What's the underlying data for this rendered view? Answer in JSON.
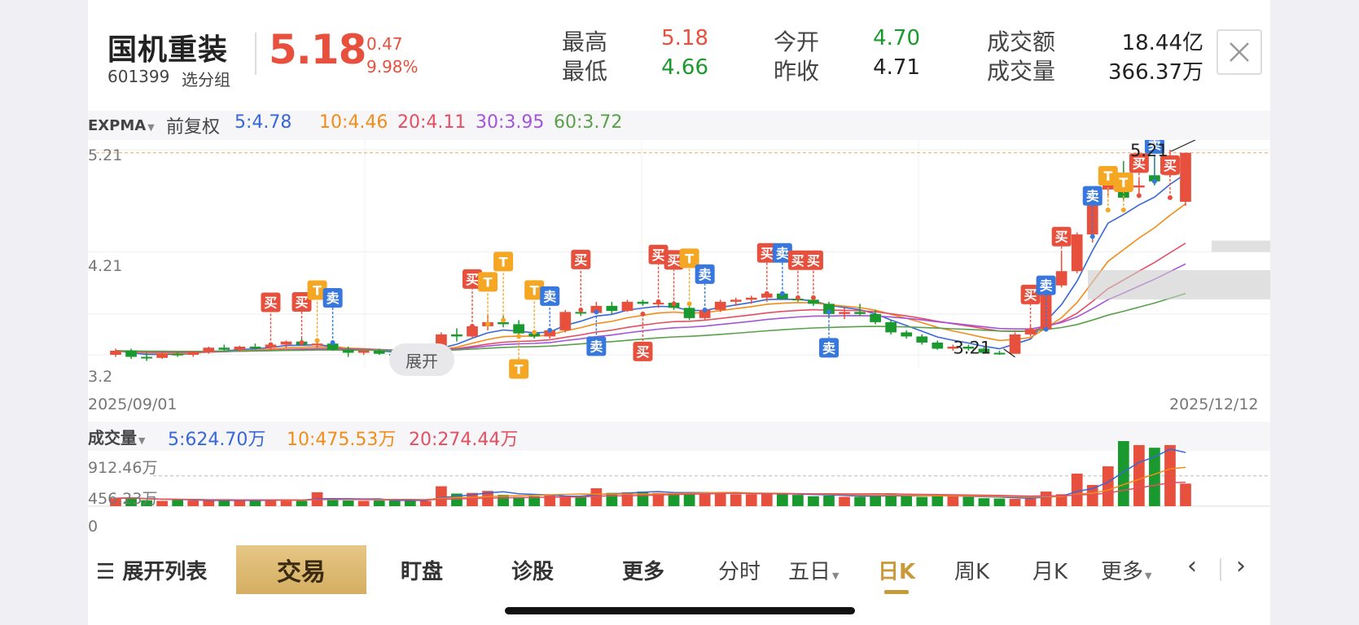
{
  "stock": {
    "name": "国机重装",
    "code": "601399",
    "group_label": "选分组",
    "price": "5.18",
    "change": "0.47",
    "change_pct": "9.98%"
  },
  "quotes": {
    "high_label": "最高",
    "high": "5.18",
    "low_label": "最低",
    "low": "4.66",
    "open_label": "今开",
    "open": "4.70",
    "prev_close_label": "昨收",
    "prev_close": "4.71",
    "amount_label": "成交额",
    "amount": "18.44亿",
    "volume_label": "成交量",
    "volume": "366.37万"
  },
  "close_icon": "close-icon",
  "indicator": {
    "selector": "EXPMA",
    "adjust": "前复权",
    "lines": [
      {
        "label": "5:4.78",
        "color": "#3866d8"
      },
      {
        "label": "10:4.46",
        "color": "#f28c18"
      },
      {
        "label": "20:4.11",
        "color": "#e34f62"
      },
      {
        "label": "30:3.95",
        "color": "#a454d8"
      },
      {
        "label": "60:3.72",
        "color": "#5aa04a"
      }
    ]
  },
  "price_axis": {
    "top": "5.21",
    "mid": "4.21",
    "low": "3.2"
  },
  "dates": {
    "start": "2025/09/01",
    "end": "2025/12/12"
  },
  "annotations": {
    "high_price": "5.21",
    "low_price": "3.21",
    "expand": "展开"
  },
  "volume": {
    "selector": "成交量",
    "lines": [
      {
        "label": "5:624.70万",
        "color": "#3866d8"
      },
      {
        "label": "10:475.53万",
        "color": "#f28c18"
      },
      {
        "label": "20:274.44万",
        "color": "#e34f62"
      }
    ],
    "axis_top": "912.46万",
    "axis_mid": "456.23万",
    "axis_zero": "0"
  },
  "signals": {
    "buy": "买",
    "sell": "卖",
    "t": "T"
  },
  "nav": {
    "expand_list": "展开列表",
    "trade": "交易",
    "watch": "盯盘",
    "diagnose": "诊股",
    "more": "更多",
    "tabs": [
      "分时",
      "五日",
      "日K",
      "周K",
      "月K",
      "更多"
    ],
    "active_tab": "日K"
  },
  "chart_data": {
    "type": "candlestick",
    "title": "",
    "x_range": [
      "2025/09/01",
      "2025/12/12"
    ],
    "ylim": [
      3.2,
      5.21
    ],
    "candles_ohlc": [
      [
        3.2,
        3.26,
        3.18,
        3.24
      ],
      [
        3.24,
        3.26,
        3.16,
        3.18
      ],
      [
        3.18,
        3.22,
        3.14,
        3.17
      ],
      [
        3.17,
        3.22,
        3.16,
        3.21
      ],
      [
        3.21,
        3.23,
        3.18,
        3.2
      ],
      [
        3.2,
        3.24,
        3.18,
        3.23
      ],
      [
        3.23,
        3.28,
        3.21,
        3.27
      ],
      [
        3.27,
        3.3,
        3.24,
        3.25
      ],
      [
        3.25,
        3.29,
        3.23,
        3.28
      ],
      [
        3.28,
        3.31,
        3.26,
        3.27
      ],
      [
        3.27,
        3.32,
        3.25,
        3.3
      ],
      [
        3.3,
        3.34,
        3.27,
        3.33
      ],
      [
        3.33,
        3.36,
        3.29,
        3.3
      ],
      [
        3.3,
        3.33,
        3.27,
        3.31
      ],
      [
        3.31,
        3.33,
        3.24,
        3.25
      ],
      [
        3.25,
        3.28,
        3.18,
        3.22
      ],
      [
        3.22,
        3.25,
        3.2,
        3.24
      ],
      [
        3.24,
        3.26,
        3.2,
        3.21
      ],
      [
        3.21,
        3.24,
        3.18,
        3.2
      ],
      [
        3.2,
        3.21,
        3.16,
        3.17
      ],
      [
        3.17,
        3.2,
        3.15,
        3.18
      ],
      [
        3.18,
        3.42,
        3.17,
        3.4
      ],
      [
        3.4,
        3.46,
        3.33,
        3.38
      ],
      [
        3.38,
        3.5,
        3.36,
        3.48
      ],
      [
        3.48,
        3.6,
        3.44,
        3.52
      ],
      [
        3.52,
        3.58,
        3.47,
        3.5
      ],
      [
        3.5,
        3.54,
        3.38,
        3.41
      ],
      [
        3.41,
        3.44,
        3.36,
        3.38
      ],
      [
        3.38,
        3.46,
        3.36,
        3.44
      ],
      [
        3.44,
        3.64,
        3.42,
        3.62
      ],
      [
        3.62,
        3.66,
        3.58,
        3.61
      ],
      [
        3.61,
        3.72,
        3.6,
        3.68
      ],
      [
        3.68,
        3.72,
        3.6,
        3.63
      ],
      [
        3.63,
        3.74,
        3.62,
        3.72
      ],
      [
        3.72,
        3.74,
        3.68,
        3.7
      ],
      [
        3.7,
        3.72,
        3.66,
        3.71
      ],
      [
        3.71,
        3.73,
        3.64,
        3.66
      ],
      [
        3.66,
        3.7,
        3.54,
        3.56
      ],
      [
        3.56,
        3.66,
        3.54,
        3.64
      ],
      [
        3.64,
        3.74,
        3.62,
        3.72
      ],
      [
        3.72,
        3.76,
        3.68,
        3.74
      ],
      [
        3.74,
        3.78,
        3.7,
        3.76
      ],
      [
        3.76,
        3.82,
        3.72,
        3.8
      ],
      [
        3.8,
        3.82,
        3.74,
        3.75
      ],
      [
        3.75,
        3.77,
        3.72,
        3.74
      ],
      [
        3.74,
        3.76,
        3.68,
        3.7
      ],
      [
        3.7,
        3.72,
        3.56,
        3.6
      ],
      [
        3.6,
        3.66,
        3.55,
        3.62
      ],
      [
        3.62,
        3.7,
        3.58,
        3.6
      ],
      [
        3.6,
        3.64,
        3.5,
        3.52
      ],
      [
        3.52,
        3.54,
        3.4,
        3.42
      ],
      [
        3.42,
        3.44,
        3.36,
        3.38
      ],
      [
        3.38,
        3.4,
        3.3,
        3.32
      ],
      [
        3.32,
        3.34,
        3.25,
        3.26
      ],
      [
        3.26,
        3.3,
        3.24,
        3.28
      ],
      [
        3.28,
        3.3,
        3.24,
        3.26
      ],
      [
        3.26,
        3.28,
        3.21,
        3.22
      ],
      [
        3.22,
        3.24,
        3.2,
        3.21
      ],
      [
        3.21,
        3.42,
        3.21,
        3.4
      ],
      [
        3.4,
        3.48,
        3.38,
        3.45
      ],
      [
        3.45,
        3.88,
        3.44,
        3.88
      ],
      [
        3.88,
        4.2,
        3.86,
        4.02
      ],
      [
        4.02,
        4.4,
        4.0,
        4.38
      ],
      [
        4.38,
        4.83,
        4.3,
        4.82
      ],
      [
        4.82,
        5.03,
        4.75,
        5.03
      ],
      [
        4.98,
        5.1,
        4.7,
        4.74
      ],
      [
        4.84,
        4.92,
        4.78,
        4.86
      ],
      [
        4.96,
        5.14,
        4.86,
        4.9
      ],
      [
        4.96,
        5.21,
        4.94,
        5.12
      ],
      [
        4.7,
        5.18,
        4.66,
        5.18
      ]
    ],
    "volume": [
      120,
      130,
      90,
      80,
      95,
      85,
      80,
      90,
      95,
      80,
      100,
      90,
      80,
      210,
      90,
      85,
      80,
      85,
      90,
      95,
      80,
      300,
      190,
      200,
      230,
      170,
      140,
      150,
      160,
      140,
      160,
      270,
      200,
      210,
      220,
      200,
      190,
      200,
      205,
      195,
      180,
      180,
      185,
      195,
      170,
      150,
      160,
      140,
      140,
      170,
      180,
      150,
      140,
      160,
      150,
      140,
      120,
      115,
      110,
      115,
      220,
      180,
      490,
      320,
      600,
      980,
      920,
      880,
      920,
      340
    ],
    "volume_unit": "万"
  }
}
